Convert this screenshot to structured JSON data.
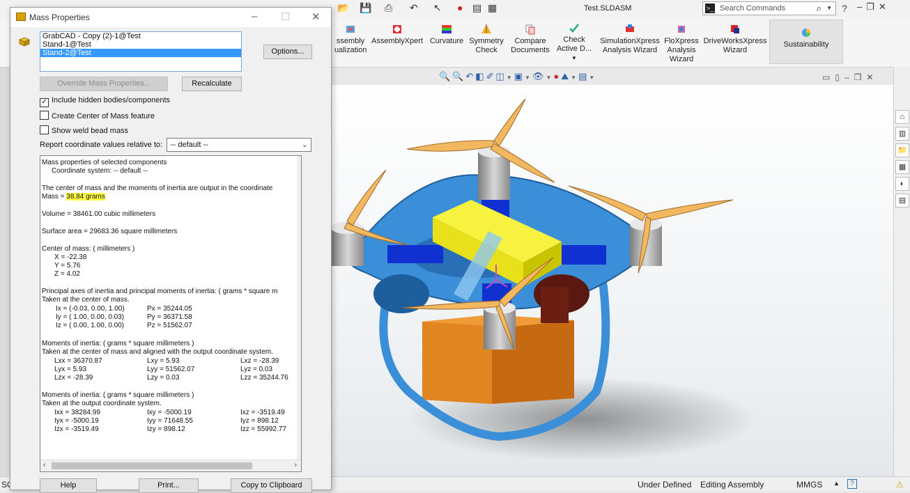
{
  "app": {
    "document_title": "Test.SLDASM",
    "search_placeholder": "Search Commands",
    "help_symbol": "?"
  },
  "ribbon": {
    "items": [
      {
        "label": "ssembly\nualization"
      },
      {
        "label": "AssemblyXpert"
      },
      {
        "label": "Curvature"
      },
      {
        "label": "Symmetry\nCheck"
      },
      {
        "label": "Compare\nDocuments"
      },
      {
        "label": "Check\nActive D..."
      },
      {
        "label": "SimulationXpress\nAnalysis Wizard"
      },
      {
        "label": "FloXpress\nAnalysis\nWizard"
      },
      {
        "label": "DriveWorksXpress\nWizard"
      },
      {
        "label": "Sustainability"
      }
    ]
  },
  "statusbar": {
    "left": "SC",
    "state": "Under Defined",
    "mode": "Editing Assembly",
    "units": "MMGS"
  },
  "dialog": {
    "title": "Mass Properties",
    "components": [
      "GrabCAD - Copy (2)-1@Test",
      "Stand-1@Test",
      "Stand-2@Test"
    ],
    "selected_index": 2,
    "options_label": "Options...",
    "override_label": "Override Mass Properties...",
    "recalculate_label": "Recalculate",
    "include_hidden": {
      "label": "Include hidden bodies/components",
      "checked": true
    },
    "create_com": {
      "label": "Create Center of Mass feature",
      "checked": false
    },
    "show_weld": {
      "label": "Show weld bead mass",
      "checked": false
    },
    "coord_label": "Report coordinate values relative to:",
    "coord_value": "-- default --",
    "help_label": "Help",
    "print_label": "Print...",
    "copy_label": "Copy to Clipboard",
    "report": {
      "header": "Mass properties of selected components",
      "coord_system": "Coordinate system: -- default --",
      "output_note": "The center of mass and the moments of inertia are output in the coordinate",
      "mass_prefix": "Mass = ",
      "mass_value": "38.84 grams",
      "volume": "Volume = 38461.00 cubic millimeters",
      "surface_area": "Surface area = 29683.36  square millimeters",
      "com_header": "Center of mass: ( millimeters )",
      "com_x": "X = -22.38",
      "com_y": "Y = 5.76",
      "com_z": "Z = 4.02",
      "principal_header": "Principal axes of inertia and principal moments of inertia: ( grams *  square m",
      "principal_taken": "Taken at the center of mass.",
      "principal_rows": [
        [
          "Ix = (-0.03,  0.00,  1.00)",
          "Px = 35244.05"
        ],
        [
          "Iy = ( 1.00,  0.00,  0.03)",
          "Py = 36371.58"
        ],
        [
          "Iz = ( 0.00,  1.00,  0.00)",
          "Pz = 51562.07"
        ]
      ],
      "moi1_header": "Moments of inertia: ( grams *  square millimeters )",
      "moi1_taken": "Taken at the center of mass and aligned with the output coordinate system.",
      "moi1_rows": [
        [
          "Lxx = 36370.87",
          "Lxy = 5.93",
          "Lxz = -28.39"
        ],
        [
          "Lyx = 5.93",
          "Lyy = 51562.07",
          "Lyz = 0.03"
        ],
        [
          "Lzx = -28.39",
          "Lzy = 0.03",
          "Lzz = 35244.76"
        ]
      ],
      "moi2_header": "Moments of inertia: ( grams *  square millimeters )",
      "moi2_taken": "Taken at the output coordinate system.",
      "moi2_rows": [
        [
          "Ixx = 38284.99",
          "Ixy = -5000.19",
          "Ixz = -3519.49"
        ],
        [
          "Iyx = -5000.19",
          "Iyy = 71648.55",
          "Iyz = 898.12"
        ],
        [
          "Izx = -3519.49",
          "Izy = 898.12",
          "Izz = 55992.77"
        ]
      ]
    }
  },
  "colors": {
    "accent_blue": "#3399ff",
    "highlight": "#ffff44",
    "frame_blue": "#3b8fd9",
    "propeller": "#f2b860",
    "battery": "#f0ea1a",
    "box": "#d9781a"
  }
}
